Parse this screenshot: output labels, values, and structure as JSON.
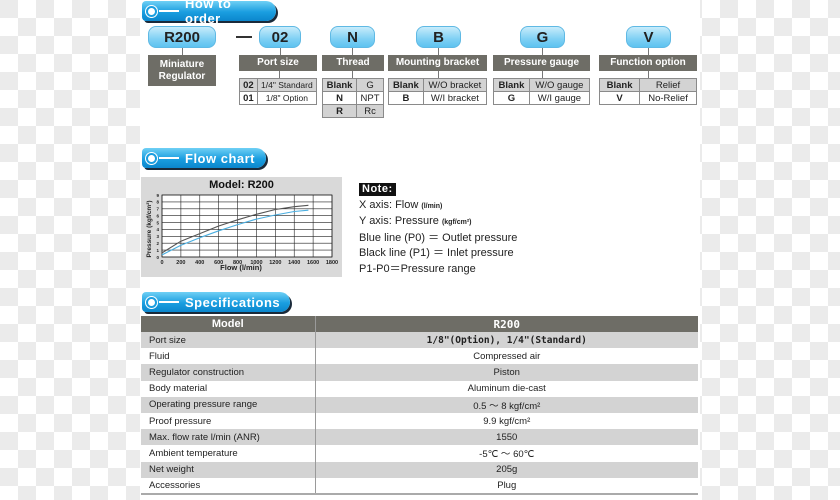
{
  "how_to_order": {
    "title": "How to order",
    "codes": [
      {
        "code": "R200",
        "label": "Miniature Regulator"
      },
      {
        "code": "02",
        "label": "Port size",
        "options": [
          [
            "02",
            "1/4\" Standard"
          ],
          [
            "01",
            "1/8\" Option"
          ]
        ]
      },
      {
        "code": "N",
        "label": "Thread",
        "options": [
          [
            "Blank",
            "G"
          ],
          [
            "N",
            "NPT"
          ],
          [
            "R",
            "Rc"
          ]
        ]
      },
      {
        "code": "B",
        "label": "Mounting bracket",
        "options": [
          [
            "Blank",
            "W/O bracket"
          ],
          [
            "B",
            "W/I bracket"
          ]
        ]
      },
      {
        "code": "G",
        "label": "Pressure gauge",
        "options": [
          [
            "Blank",
            "W/O gauge"
          ],
          [
            "G",
            "W/I gauge"
          ]
        ]
      },
      {
        "code": "V",
        "label": "Function option",
        "options": [
          [
            "Blank",
            "Relief"
          ],
          [
            "V",
            "No-Relief"
          ]
        ]
      }
    ],
    "separator": "—"
  },
  "flow_chart": {
    "title": "Flow chart",
    "note": {
      "title": "Note:",
      "x_axis": "X axis: Flow",
      "x_unit": "(l/min)",
      "y_axis": "Y axis: Pressure",
      "y_unit": "(kgf/cm²)",
      "blue": "Blue line (P0) ＝ Outlet pressure",
      "black": "Black line (P1) ＝ Inlet pressure",
      "range": "P1-P0＝Pressure range"
    }
  },
  "chart_data": {
    "type": "line",
    "title": "Model: R200",
    "xlabel": "Flow (l/min)",
    "ylabel": "Pressure (kgf/cm²)",
    "xlim": [
      0,
      1800
    ],
    "ylim": [
      0,
      9
    ],
    "xticks": [
      0,
      200,
      400,
      600,
      800,
      1000,
      1200,
      1400,
      1600,
      1800
    ],
    "yticks": [
      0,
      1,
      2,
      3,
      4,
      5,
      6,
      7,
      8,
      9
    ],
    "grid": true,
    "series": [
      {
        "name": "P1 (Inlet pressure)",
        "color": "#555555",
        "x": [
          0,
          200,
          400,
          600,
          800,
          1000,
          1200,
          1400,
          1550
        ],
        "y": [
          0.6,
          2.3,
          3.4,
          4.5,
          5.4,
          6.2,
          6.9,
          7.3,
          7.5
        ]
      },
      {
        "name": "P0 (Outlet pressure)",
        "color": "#4aaee0",
        "x": [
          0,
          200,
          400,
          600,
          800,
          1000,
          1200,
          1400,
          1550
        ],
        "y": [
          0.3,
          1.7,
          2.8,
          3.8,
          4.7,
          5.5,
          6.1,
          6.6,
          6.8
        ]
      }
    ]
  },
  "specifications": {
    "title": "Specifications",
    "header": [
      "Model",
      "R200"
    ],
    "rows": [
      [
        "Port size",
        "1/8\"(Option), 1/4\"(Standard)"
      ],
      [
        "Fluid",
        "Compressed air"
      ],
      [
        "Regulator construction",
        "Piston"
      ],
      [
        "Body material",
        "Aluminum die-cast"
      ],
      [
        "Operating pressure range",
        "0.5 ～ 8 kgf/cm²"
      ],
      [
        "Proof pressure",
        "9.9 kgf/cm²"
      ],
      [
        "Max. flow rate  l/min (ANR)",
        "1550"
      ],
      [
        "Ambient temperature",
        "-5℃ ～ 60℃"
      ],
      [
        "Net weight",
        "205g"
      ],
      [
        "Accessories",
        "Plug"
      ]
    ]
  }
}
